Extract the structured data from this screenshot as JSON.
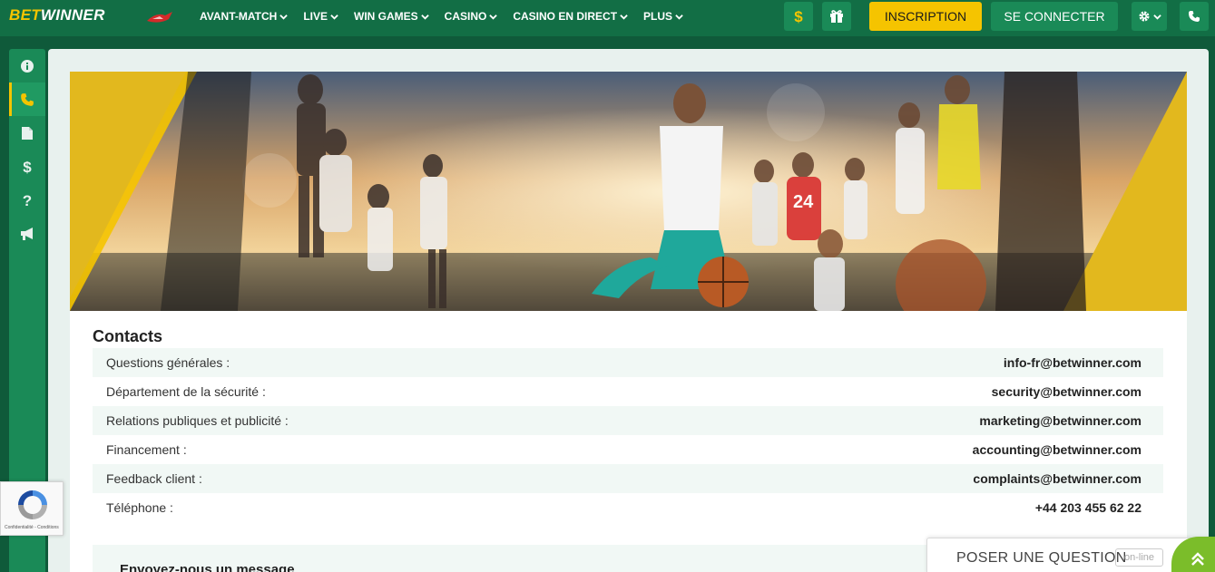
{
  "header": {
    "logo_left": "BET",
    "logo_right": "WINNER",
    "nav": [
      {
        "label": "AVANT-MATCH"
      },
      {
        "label": "LIVE"
      },
      {
        "label": "WIN GAMES"
      },
      {
        "label": "CASINO"
      },
      {
        "label": "CASINO EN DIRECT"
      },
      {
        "label": "PLUS"
      }
    ],
    "icons": [
      "dollar-icon",
      "gift-icon",
      "gear-icon",
      "phone-icon"
    ],
    "signup_label": "INSCRIPTION",
    "login_label": "SE CONNECTER"
  },
  "sidebar": {
    "items": [
      {
        "icon": "info-icon"
      },
      {
        "icon": "phone-icon",
        "active": true
      },
      {
        "icon": "document-icon"
      },
      {
        "icon": "dollar-icon"
      },
      {
        "icon": "question-icon"
      },
      {
        "icon": "megaphone-icon"
      }
    ]
  },
  "contacts": {
    "title": "Contacts",
    "rows": [
      {
        "label": "Questions générales :",
        "value": "info-fr@betwinner.com"
      },
      {
        "label": "Département de la sécurité :",
        "value": "security@betwinner.com"
      },
      {
        "label": "Relations publiques et publicité :",
        "value": "marketing@betwinner.com"
      },
      {
        "label": "Financement :",
        "value": "accounting@betwinner.com"
      },
      {
        "label": "Feedback client :",
        "value": "complaints@betwinner.com"
      },
      {
        "label": "Téléphone :",
        "value": "+44 203 455 62 22"
      }
    ]
  },
  "message": {
    "title": "Envoyez-nous un message"
  },
  "recaptcha": {
    "terms": "Confidentialité - Conditions"
  },
  "chat": {
    "label": "POSER UNE QUESTION",
    "status": "on-line"
  },
  "colors": {
    "brand_green": "#126e45",
    "accent_yellow": "#f5c400",
    "chat_green": "#7bbd2a"
  }
}
